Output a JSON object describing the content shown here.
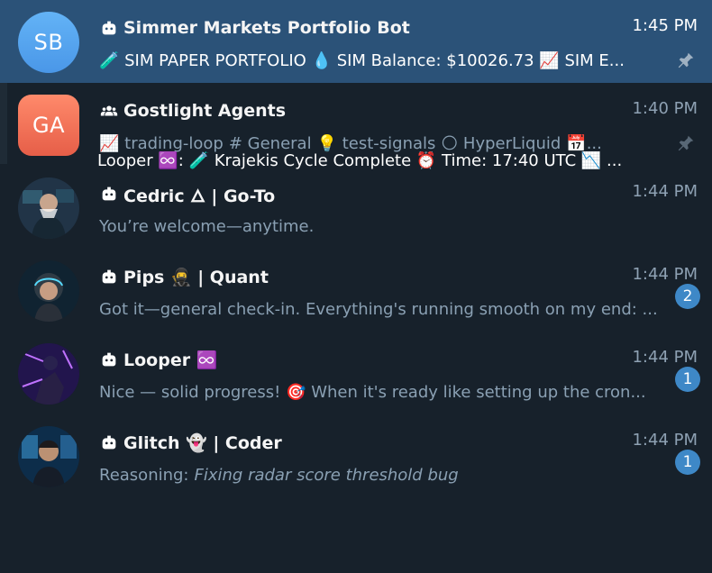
{
  "chats": [
    {
      "initials": "SB",
      "title": "Simmer Markets Portfolio Bot",
      "time": "1:45 PM",
      "preview": "🧪 SIM PAPER PORTFOLIO  💧 SIM Balance: $10026.73  📈 SIM E..."
    },
    {
      "initials": "GA",
      "title": "Gostlight Agents",
      "time": "1:40 PM",
      "topics": [
        "📈 trading-loop",
        "# General",
        "💡 test-signals",
        "🌕 HyperLiquid",
        "📅..."
      ],
      "preview_line2": "Looper ♾️: 🧪 Krajekis Cycle Complete ⏰ Time: 17:40 UTC 📉 ..."
    },
    {
      "title": "Cedric 🜂 | Go-To",
      "time": "1:44 PM",
      "preview": "You’re welcome—anytime."
    },
    {
      "title": "Pips 🥷 | Quant",
      "time": "1:44 PM",
      "preview": "Got it—general check-in. Everything's running smooth on my end: ...",
      "badge": "2"
    },
    {
      "title": "Looper ♾️",
      "time": "1:44 PM",
      "preview": "Nice — solid progress! 🎯  When it's ready like setting up the cron...",
      "badge": "1"
    },
    {
      "title": "Glitch 👻 | Coder",
      "time": "1:44 PM",
      "preview_label": "Reasoning:",
      "preview_italic": "Fixing radar score threshold bug",
      "badge": "1"
    }
  ]
}
